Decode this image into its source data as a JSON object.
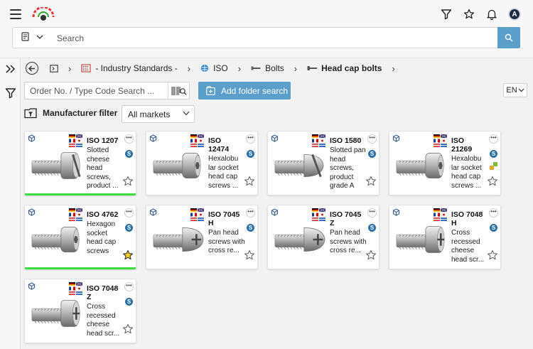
{
  "header": {
    "search_placeholder": "Search",
    "icons": [
      "menu-icon",
      "filter-icon",
      "star-icon",
      "bell-icon",
      "user-avatar"
    ],
    "avatar_initial": "A"
  },
  "breadcrumb": {
    "items": [
      {
        "label": "- Industry Standards -"
      },
      {
        "label": "ISO"
      },
      {
        "label": "Bolts"
      },
      {
        "label": "Head cap bolts"
      }
    ]
  },
  "toolbar": {
    "order_placeholder": "Order No. / Type Code Search ...",
    "add_folder_label": "Add folder search",
    "language": "EN"
  },
  "filter": {
    "label": "Manufacturer filter",
    "markets_value": "All markets"
  },
  "colors": {
    "accent": "#5b9ec9",
    "selected_bar": "#3fdc3f",
    "badge": "#2a6fa8",
    "star_active": "#f5d21c"
  },
  "cards": [
    {
      "title": "ISO 1207",
      "desc": "Slotted cheese head screws, product ...",
      "head": "cheese-slot",
      "favorite": false,
      "selected": true
    },
    {
      "title": "ISO 12474",
      "desc": "Hexalobu lar socket head cap screws ...",
      "head": "socket",
      "favorite": false,
      "selected": false
    },
    {
      "title": "ISO 1580",
      "desc": "Slotted pan head screws, product grade A",
      "head": "pan-slot",
      "favorite": false,
      "selected": false
    },
    {
      "title": "ISO 21269",
      "desc": "Hexalobu lar socket head cap screws ...",
      "head": "socket",
      "favorite": false,
      "selected": false,
      "extra_icon": true
    },
    {
      "title": "ISO 4762",
      "desc": "Hexagon socket head cap screws",
      "head": "socket",
      "favorite": true,
      "selected": true
    },
    {
      "title": "ISO 7045 H",
      "desc": "Pan head screws with cross re...",
      "head": "pan-cross",
      "favorite": false,
      "selected": false
    },
    {
      "title": "ISO 7045 Z",
      "desc": "Pan head screws with cross re...",
      "head": "pan-cross",
      "favorite": false,
      "selected": false
    },
    {
      "title": "ISO 7048 H",
      "desc": "Cross recessed cheese head scr...",
      "head": "cheese-cross",
      "favorite": false,
      "selected": false
    },
    {
      "title": "ISO 7048 Z",
      "desc": "Cross recessed cheese head scr...",
      "head": "cheese-cross",
      "favorite": false,
      "selected": false
    }
  ]
}
